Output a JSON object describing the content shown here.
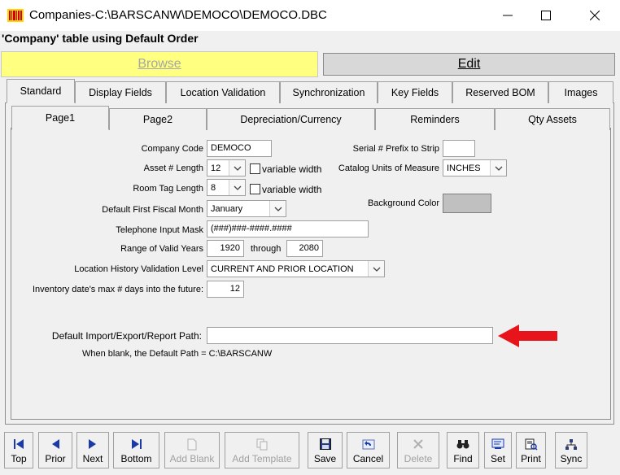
{
  "window": {
    "title": "Companies-C:\\BARSCANW\\DEMOCO\\DEMOCO.DBC"
  },
  "header": {
    "subtitle": "'Company' table using Default Order"
  },
  "mode": {
    "browse_label": "Browse",
    "edit_label": "Edit"
  },
  "tabs": [
    "Standard",
    "Display Fields",
    "Location Validation",
    "Synchronization",
    "Key Fields",
    "Reserved BOM",
    "Images"
  ],
  "subtabs": [
    "Page1",
    "Page2",
    "Depreciation/Currency",
    "Reminders",
    "Qty Assets"
  ],
  "form": {
    "company_code": {
      "label": "Company Code",
      "value": "DEMOCO"
    },
    "asset_length": {
      "label": "Asset # Length",
      "value": "12"
    },
    "variable_width_label": "variable width",
    "room_tag_length": {
      "label": "Room Tag Length",
      "value": "8"
    },
    "fiscal_month": {
      "label": "Default First Fiscal Month",
      "value": "January"
    },
    "phone_mask": {
      "label": "Telephone Input Mask",
      "value": "(###)###-####.####"
    },
    "valid_years": {
      "label": "Range of Valid Years",
      "from": "1920",
      "through_label": "through",
      "to": "2080"
    },
    "history_validation": {
      "label": "Location History Validation Level",
      "value": "CURRENT AND PRIOR LOCATION"
    },
    "inventory_days": {
      "label": "Inventory date's max # days into the future:",
      "value": "12"
    },
    "serial_prefix": {
      "label": "Serial # Prefix to Strip",
      "value": ""
    },
    "catalog_units": {
      "label": "Catalog Units of Measure",
      "value": "INCHES"
    },
    "background_color": {
      "label": "Background Color",
      "value": "#c0c0c0"
    },
    "import_path": {
      "label": "Default Import/Export/Report Path:",
      "value": ""
    },
    "default_path_note": "When blank, the Default Path =  C:\\BARSCANW"
  },
  "annotation_arrow_color": "#e8141c",
  "toolbar": {
    "top": "Top",
    "prior": "Prior",
    "next": "Next",
    "bottom": "Bottom",
    "add_blank": "Add Blank",
    "add_template": "Add Template",
    "save": "Save",
    "cancel": "Cancel",
    "delete": "Delete",
    "find": "Find",
    "set": "Set",
    "print": "Print",
    "sync": "Sync"
  }
}
